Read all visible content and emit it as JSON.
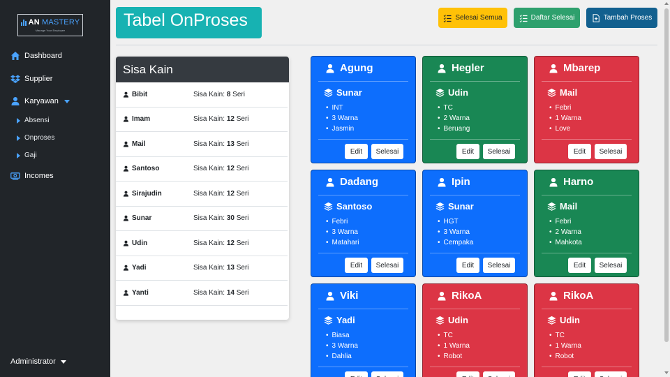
{
  "brand": {
    "name_a": "AN",
    "name_b": "MASTERY",
    "tagline": "Manage Your Employee"
  },
  "sidebar": {
    "dashboard": "Dashboard",
    "supplier": "Supplier",
    "karyawan": "Karyawan",
    "absensi": "Absensi",
    "onproses": "Onproses",
    "gaji": "Gaji",
    "incomes": "Incomes",
    "user": "Administrator"
  },
  "header": {
    "title": "Tabel OnProses",
    "btn_selesai_semua": "Selesai Semua",
    "btn_daftar_selesai": "Daftar Selesai",
    "btn_tambah_proses": "Tambah Proses"
  },
  "sisa_kain": {
    "title": "Sisa Kain",
    "prefix": "Sisa Kain:",
    "unit": "Seri",
    "rows": [
      {
        "name": "Bibit",
        "qty": "8"
      },
      {
        "name": "Imam",
        "qty": "12"
      },
      {
        "name": "Mail",
        "qty": "13"
      },
      {
        "name": "Santoso",
        "qty": "12"
      },
      {
        "name": "Sirajudin",
        "qty": "12"
      },
      {
        "name": "Sunar",
        "qty": "30"
      },
      {
        "name": "Udin",
        "qty": "12"
      },
      {
        "name": "Yadi",
        "qty": "13"
      },
      {
        "name": "Yanti",
        "qty": "14"
      }
    ]
  },
  "cards_common": {
    "edit": "Edit",
    "selesai": "Selesai"
  },
  "cards": [
    {
      "name": "Agung",
      "color": "#0d6efd",
      "karyawan": "Sunar",
      "items": [
        "INT",
        "3 Warna",
        "Jasmin"
      ]
    },
    {
      "name": "Hegler",
      "color": "#198754",
      "karyawan": "Udin",
      "items": [
        "TC",
        "2 Warna",
        "Beruang"
      ]
    },
    {
      "name": "Mbarep",
      "color": "#dc3545",
      "karyawan": "Mail",
      "items": [
        "Febri",
        "1 Warna",
        "Love"
      ]
    },
    {
      "name": "Dadang",
      "color": "#0d6efd",
      "karyawan": "Santoso",
      "items": [
        "Febri",
        "3 Warna",
        "Matahari"
      ]
    },
    {
      "name": "Ipin",
      "color": "#0d6efd",
      "karyawan": "Sunar",
      "items": [
        "HGT",
        "3 Warna",
        "Cempaka"
      ]
    },
    {
      "name": "Harno",
      "color": "#198754",
      "karyawan": "Mail",
      "items": [
        "Febri",
        "2 Warna",
        "Mahkota"
      ]
    },
    {
      "name": "Viki",
      "color": "#0d6efd",
      "karyawan": "Yadi",
      "items": [
        "Biasa",
        "3 Warna",
        "Dahlia"
      ]
    },
    {
      "name": "RikoA",
      "color": "#dc3545",
      "karyawan": "Udin",
      "items": [
        "TC",
        "1 Warna",
        "Robot"
      ]
    },
    {
      "name": "RikoA",
      "color": "#dc3545",
      "karyawan": "Udin",
      "items": [
        "TC",
        "1 Warna",
        "Robot"
      ]
    }
  ]
}
